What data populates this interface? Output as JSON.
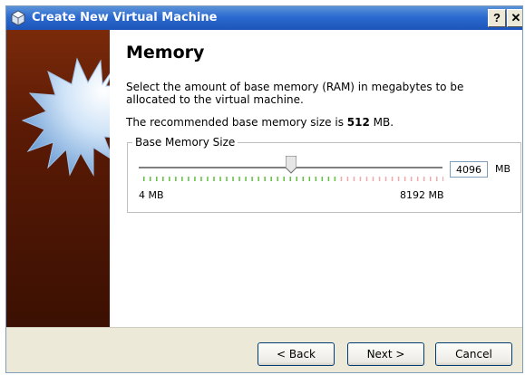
{
  "window": {
    "title": "Create New Virtual Machine",
    "help_label": "?",
    "close_label": "✕"
  },
  "page": {
    "heading": "Memory",
    "description": "Select the amount of base memory (RAM) in megabytes to be allocated to the virtual machine.",
    "recommended_prefix": "The recommended base memory size is ",
    "recommended_value": "512",
    "recommended_suffix": " MB."
  },
  "memory": {
    "group_title": "Base Memory Size",
    "value": "4096",
    "unit": "MB",
    "min_label": "4 MB",
    "max_label": "8192 MB",
    "slider_fraction": 0.5
  },
  "buttons": {
    "back": "< Back",
    "next": "Next >",
    "cancel": "Cancel"
  },
  "colors": {
    "titlebar": "#2c6ad0",
    "tick_ok": "#5fbf3f",
    "tick_warn": "#f0a8a8"
  }
}
